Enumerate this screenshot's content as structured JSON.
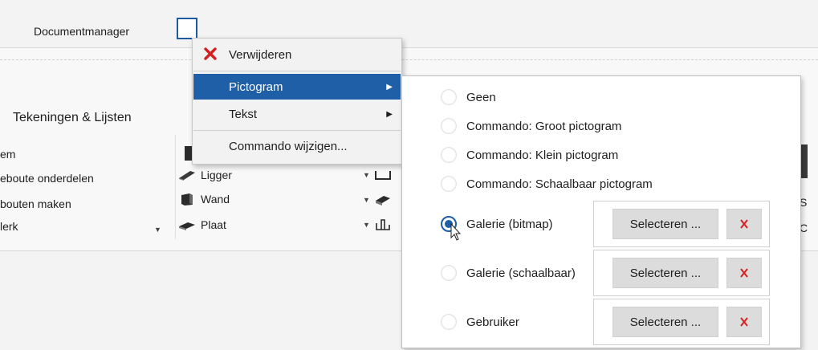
{
  "tabs": {
    "document_manager": "Documentmanager"
  },
  "ribbon": {
    "group_label": "Tekeningen & Lijsten",
    "left_items": [
      "em",
      "eboute onderdelen",
      "bouten maken",
      "lerk"
    ],
    "mid_items": [
      "Ligger",
      "Wand",
      "Plaat"
    ],
    "right_fragments": [
      "S",
      "C"
    ]
  },
  "context_menu": {
    "items": [
      {
        "label": "Verwijderen",
        "icon": "delete-x-icon"
      },
      {
        "label": "Pictogram",
        "has_submenu": true,
        "active": true
      },
      {
        "label": "Tekst",
        "has_submenu": true
      },
      {
        "label": "Commando wijzigen..."
      }
    ]
  },
  "submenu": {
    "options": [
      {
        "label": "Geen",
        "checked": false
      },
      {
        "label": "Commando: Groot pictogram",
        "checked": false
      },
      {
        "label": "Commando: Klein pictogram",
        "checked": false
      },
      {
        "label": "Commando: Schaalbaar pictogram",
        "checked": false
      },
      {
        "label": "Galerie (bitmap)",
        "checked": true
      },
      {
        "label": "Galerie (schaalbaar)",
        "checked": false
      },
      {
        "label": "Gebruiker",
        "checked": false
      }
    ],
    "select_label": "Selecteren ...",
    "clear_icon": "red-x-icon"
  },
  "colors": {
    "accent": "#1f5fa8",
    "delete_red": "#d42020"
  }
}
